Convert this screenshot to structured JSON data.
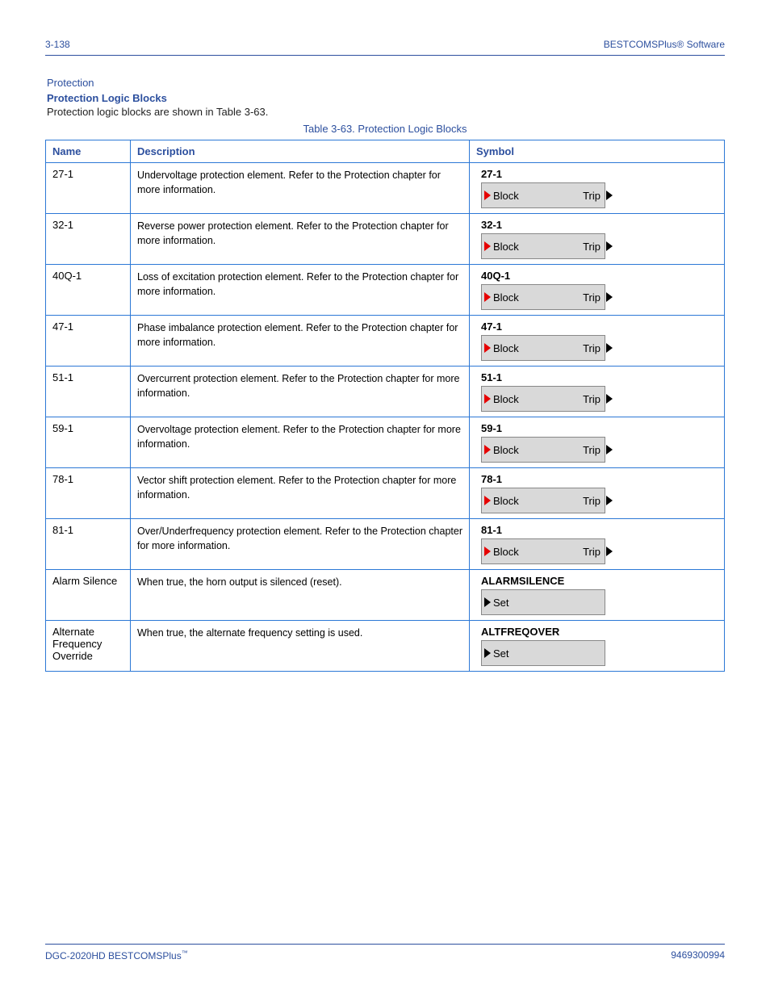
{
  "header": {
    "page_num": "3-138",
    "section": "BESTCOMSPlus® Software"
  },
  "sub1": "Protection",
  "sub2": "Protection Logic Blocks",
  "intro": "Protection logic blocks are shown in Table 3-63.",
  "table_caption": "Table 3-63. Protection Logic Blocks",
  "columns": {
    "c1": "Name",
    "c2": "Description",
    "c3": "Symbol"
  },
  "rows": [
    {
      "name": "27-1",
      "desc": "Undervoltage protection element. Refer to the Protection chapter for more information.",
      "sym": {
        "label": "27-1",
        "type": "dual",
        "left": "Block",
        "right": "Trip"
      }
    },
    {
      "name": "32-1",
      "desc": "Reverse power protection element. Refer to the Protection chapter for more information.",
      "sym": {
        "label": "32-1",
        "type": "dual",
        "left": "Block",
        "right": "Trip"
      }
    },
    {
      "name": "40Q-1",
      "desc": "Loss of excitation protection element. Refer to the Protection chapter for more information.",
      "sym": {
        "label": "40Q-1",
        "type": "dual",
        "left": "Block",
        "right": "Trip"
      }
    },
    {
      "name": "47-1",
      "desc": "Phase imbalance protection element. Refer to the Protection chapter for more information.",
      "sym": {
        "label": "47-1",
        "type": "dual",
        "left": "Block",
        "right": "Trip"
      }
    },
    {
      "name": "51-1",
      "desc": "Overcurrent protection element. Refer to the Protection chapter for more information.",
      "sym": {
        "label": "51-1",
        "type": "dual",
        "left": "Block",
        "right": "Trip"
      }
    },
    {
      "name": "59-1",
      "desc": "Overvoltage protection element. Refer to the Protection chapter for more information.",
      "sym": {
        "label": "59-1",
        "type": "dual",
        "left": "Block",
        "right": "Trip"
      }
    },
    {
      "name": "78-1",
      "desc": "Vector shift protection element. Refer to the Protection chapter for more information.",
      "sym": {
        "label": "78-1",
        "type": "dual",
        "left": "Block",
        "right": "Trip"
      }
    },
    {
      "name": "81-1",
      "desc": "Over/Underfrequency protection element. Refer to the Protection chapter for more information.",
      "sym": {
        "label": "81-1",
        "type": "dual",
        "left": "Block",
        "right": "Trip"
      }
    },
    {
      "name": "Alarm Silence",
      "desc": "When true, the horn output is silenced (reset).",
      "sym": {
        "label": "ALARMSILENCE",
        "type": "single",
        "left": "Set"
      }
    },
    {
      "name": "Alternate Frequency Override",
      "desc": "When true, the alternate frequency setting is used.",
      "sym": {
        "label": "ALTFREQOVER",
        "type": "single",
        "left": "Set"
      }
    }
  ],
  "footer": {
    "left_a": "DGC-2020HD",
    "left_b": "BESTCOMSPlus",
    "right": "9469300994"
  },
  "tm": "™"
}
